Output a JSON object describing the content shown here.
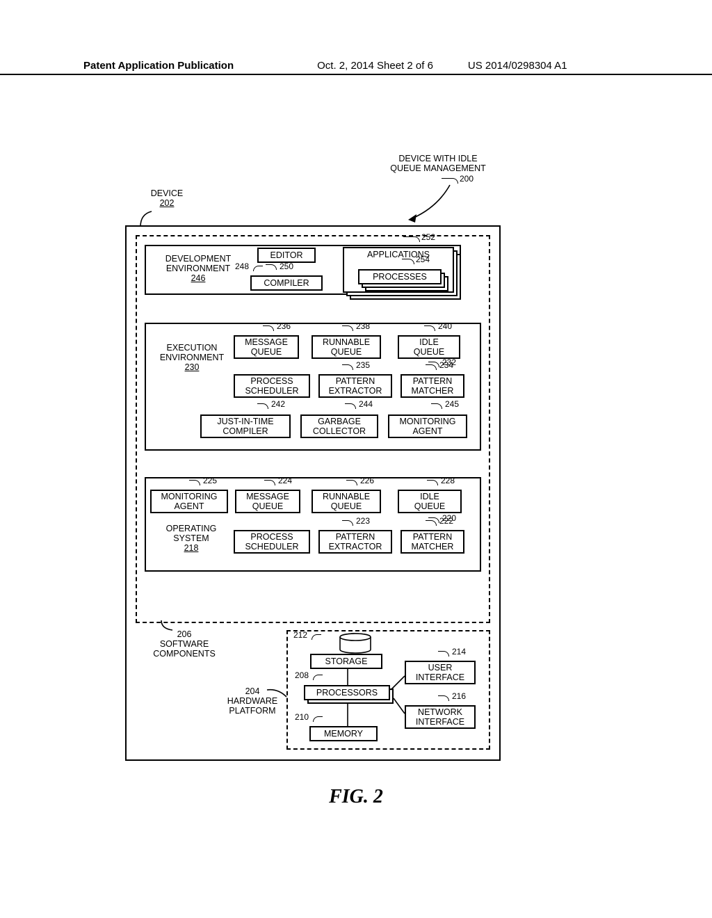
{
  "header": {
    "left": "Patent Application Publication",
    "mid": "Oct. 2, 2014  Sheet 2 of 6",
    "right": "US 2014/0298304 A1"
  },
  "diagram": {
    "title_top": "DEVICE WITH IDLE\nQUEUE MANAGEMENT",
    "title_top_ref": "200",
    "device_label": "DEVICE",
    "device_ref": "202",
    "dev_env": {
      "label": "DEVELOPMENT\nENVIRONMENT",
      "ref_under": "246",
      "editor": "EDITOR",
      "editor_ref": "248",
      "compiler": "COMPILER",
      "compiler_ref": "250"
    },
    "applications": {
      "label": "APPLICATIONS",
      "ref": "252",
      "processes": "PROCESSES",
      "processes_ref": "254"
    },
    "exec_env": {
      "label": "EXECUTION\nENVIRONMENT",
      "ref_under": "230",
      "msg_q": "MESSAGE\nQUEUE",
      "msg_q_ref": "236",
      "run_q": "RUNNABLE\nQUEUE",
      "run_q_ref": "238",
      "idle_q": "IDLE\nQUEUE",
      "idle_q_ref": "240",
      "proc_sched": "PROCESS\nSCHEDULER",
      "proc_sched_ref": "232",
      "pat_ext": "PATTERN\nEXTRACTOR",
      "pat_ext_ref": "235",
      "pat_match": "PATTERN\nMATCHER",
      "pat_match_ref": "234",
      "jit": "JUST-IN-TIME\nCOMPILER",
      "jit_ref": "242",
      "gc": "GARBAGE\nCOLLECTOR",
      "gc_ref": "244",
      "mon": "MONITORING\nAGENT",
      "mon_ref": "245"
    },
    "os": {
      "label": "OPERATING\nSYSTEM",
      "ref_under": "218",
      "mon": "MONITORING\nAGENT",
      "mon_ref": "225",
      "msg_q": "MESSAGE\nQUEUE",
      "msg_q_ref": "224",
      "run_q": "RUNNABLE\nQUEUE",
      "run_q_ref": "226",
      "idle_q": "IDLE\nQUEUE",
      "idle_q_ref": "228",
      "proc_sched": "PROCESS\nSCHEDULER",
      "proc_sched_ref": "220",
      "pat_ext": "PATTERN\nEXTRACTOR",
      "pat_ext_ref": "223",
      "pat_match": "PATTERN\nMATCHER",
      "pat_match_ref": "222"
    },
    "sw_label": "SOFTWARE\nCOMPONENTS",
    "sw_ref": "206",
    "hw": {
      "label": "HARDWARE\nPLATFORM",
      "ref": "204",
      "storage": "STORAGE",
      "storage_ref": "212",
      "processors": "PROCESSORS",
      "processors_ref": "208",
      "memory": "MEMORY",
      "memory_ref": "210",
      "ui": "USER\nINTERFACE",
      "ui_ref": "214",
      "net": "NETWORK\nINTERFACE",
      "net_ref": "216"
    }
  },
  "figure_label": "FIG. 2"
}
